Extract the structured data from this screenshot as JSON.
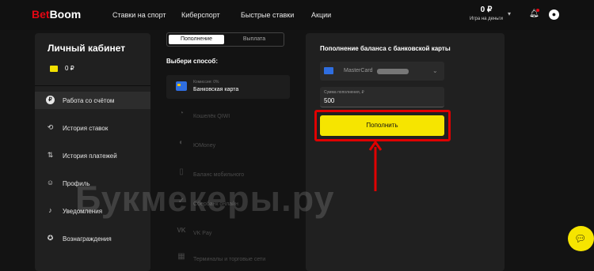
{
  "header": {
    "logo_part1": "Bet",
    "logo_part2": "Boom",
    "nav": [
      "Ставки на спорт",
      "Киберспорт",
      "Быстрые ставки",
      "Акции"
    ],
    "balance_amount": "0 ₽",
    "balance_label": "Игра на деньги",
    "icons": [
      "chevron-down-icon",
      "bell-icon",
      "user-icon"
    ]
  },
  "sidebar": {
    "title": "Личный кабинет",
    "balance": "0 ₽",
    "items": [
      {
        "label": "Работа со счётом",
        "icon": "ruble-icon",
        "active": true
      },
      {
        "label": "История ставок",
        "icon": "history-icon"
      },
      {
        "label": "История платежей",
        "icon": "transfer-icon"
      },
      {
        "label": "Профиль",
        "icon": "profile-icon"
      },
      {
        "label": "Уведомления",
        "icon": "bell-icon"
      },
      {
        "label": "Вознаграждения",
        "icon": "star-icon"
      }
    ]
  },
  "methods": {
    "tabs": [
      "Пополнение",
      "Выплата"
    ],
    "active_tab": "Пополнение",
    "choose_label": "Выбери способ:",
    "list": [
      {
        "sub": "Комиссия: 0%",
        "name": "Банковская карта",
        "icon": "card-icon",
        "selected": true
      },
      {
        "name": "Кошелёк QIWI",
        "icon": "qiwi-icon"
      },
      {
        "name": "ЮMoney",
        "icon": "yoomoney-icon"
      },
      {
        "name": "Баланс мобильного",
        "icon": "phone-icon"
      },
      {
        "name": "Сбербанк онлайн",
        "icon": "sber-icon"
      },
      {
        "name": "VK Pay",
        "icon": "vk-icon"
      },
      {
        "name": "Терминалы и торговые сети",
        "icon": "terminal-icon"
      }
    ]
  },
  "deposit": {
    "title": "Пополнение баланса с банковской карты",
    "card_label": "MasterCard",
    "amount_label": "Сумма пополнения, ₽",
    "amount_value": "500",
    "pay_button": "Пополнить"
  },
  "watermark": "Букмекеры.ру",
  "accent_yellow": "#f6e500",
  "highlight_red": "#e00000"
}
